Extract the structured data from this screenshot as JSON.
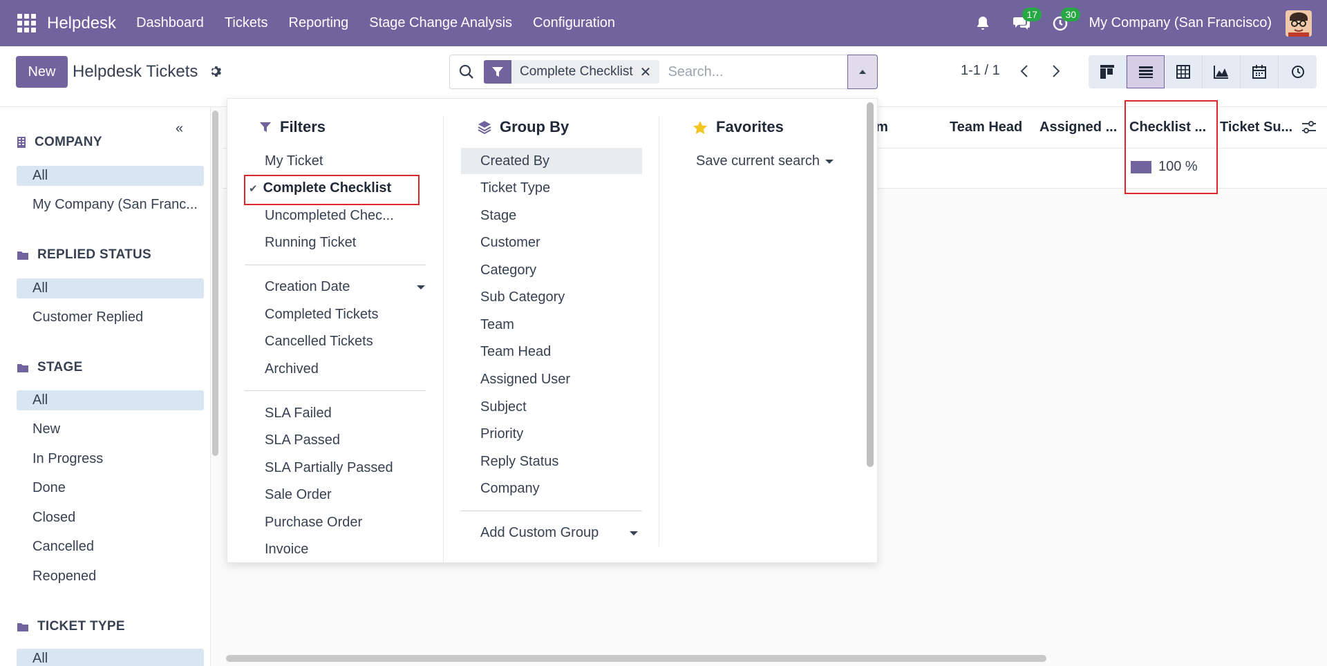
{
  "navbar": {
    "brand": "Helpdesk",
    "menu": [
      "Dashboard",
      "Tickets",
      "Reporting",
      "Stage Change Analysis",
      "Configuration"
    ],
    "messages_count": "17",
    "activities_count": "30",
    "company": "My Company (San Francisco)",
    "accent": "#71639e"
  },
  "control": {
    "new_label": "New",
    "title": "Helpdesk Tickets",
    "facet_label": "Complete Checklist",
    "facet_remove": "✕",
    "search_placeholder": "Search...",
    "pager": "1-1 / 1"
  },
  "sidebar": {
    "sections": [
      {
        "title": "COMPANY",
        "items": [
          "All",
          "My Company (San Franc..."
        ]
      },
      {
        "title": "REPLIED STATUS",
        "items": [
          "All",
          "Customer Replied"
        ]
      },
      {
        "title": "STAGE",
        "items": [
          "All",
          "New",
          "In Progress",
          "Done",
          "Closed",
          "Cancelled",
          "Reopened"
        ]
      },
      {
        "title": "TICKET TYPE",
        "items": [
          "All"
        ]
      }
    ]
  },
  "list": {
    "columns": [
      "am",
      "Team Head",
      "Assigned ...",
      "Checklist ...",
      "Ticket Su..."
    ],
    "row": {
      "checklist_progress": "100 %"
    }
  },
  "dropdown": {
    "filters": {
      "title": "Filters",
      "group1": [
        "My Ticket",
        "Complete Checklist",
        "Uncompleted Chec...",
        "Running Ticket"
      ],
      "group2": [
        "Creation Date",
        "Completed Tickets",
        "Cancelled Tickets",
        "Archived"
      ],
      "group3": [
        "SLA Failed",
        "SLA Passed",
        "SLA Partially Passed",
        "Sale Order",
        "Purchase Order",
        "Invoice"
      ]
    },
    "groupby": {
      "title": "Group By",
      "items": [
        "Created By",
        "Ticket Type",
        "Stage",
        "Customer",
        "Category",
        "Sub Category",
        "Team",
        "Team Head",
        "Assigned User",
        "Subject",
        "Priority",
        "Reply Status",
        "Company"
      ],
      "custom": "Add Custom Group"
    },
    "favorites": {
      "title": "Favorites",
      "save": "Save current search"
    }
  }
}
